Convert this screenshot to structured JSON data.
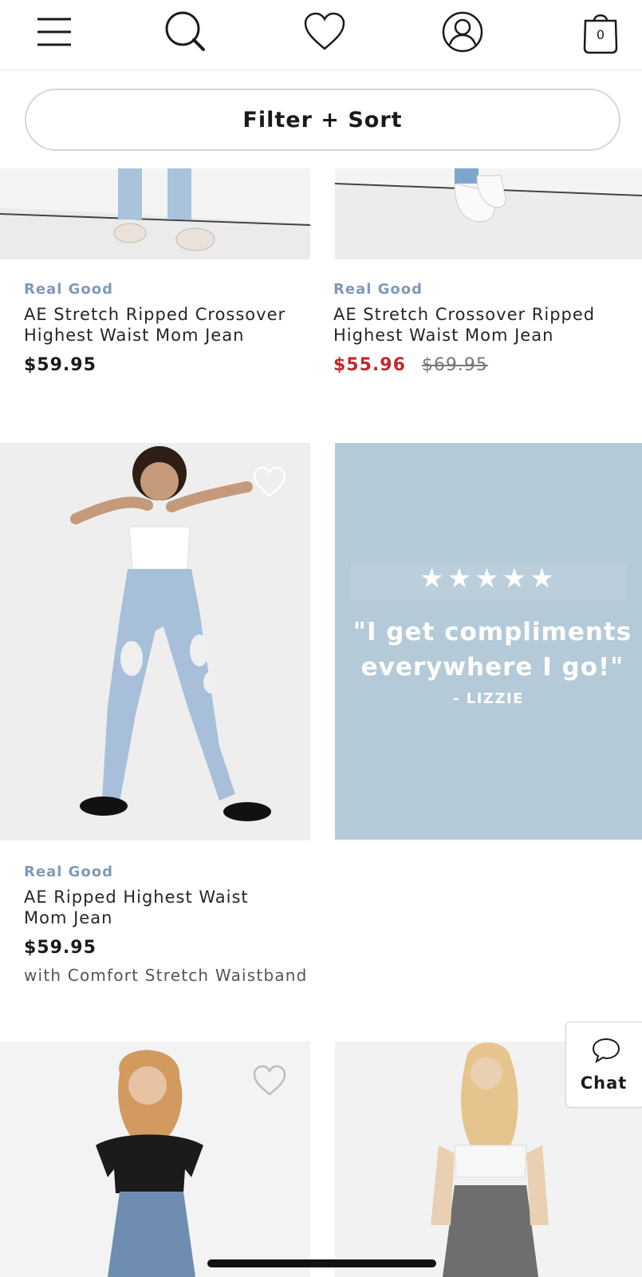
{
  "header": {
    "icons": [
      "menu-icon",
      "search-icon",
      "heart-icon",
      "account-icon",
      "bag-icon"
    ],
    "bag_count": "0"
  },
  "filter": {
    "label": "Filter + Sort"
  },
  "products": [
    {
      "brand": "Real Good",
      "name": "AE Stretch Ripped Crossover Highest Waist Mom Jean",
      "price": "$59.95"
    },
    {
      "brand": "Real Good",
      "name": "AE Stretch Crossover Ripped Highest Waist Mom Jean",
      "sale_price": "$55.96",
      "original_price": "$69.95"
    },
    {
      "brand": "Real Good",
      "name": "AE Ripped Highest Waist Mom Jean",
      "price": "$59.95",
      "note": "with Comfort Stretch Waistband"
    }
  ],
  "review": {
    "stars": "★★★★★",
    "rating": 5,
    "quote": "\"I get compliments everywhere I go!\"",
    "author": "- LIZZIE",
    "background_color": "#b5cad8"
  },
  "chat": {
    "label": "Chat"
  },
  "colors": {
    "brand_text": "#7f9ab7",
    "sale_price": "#c0282d"
  }
}
